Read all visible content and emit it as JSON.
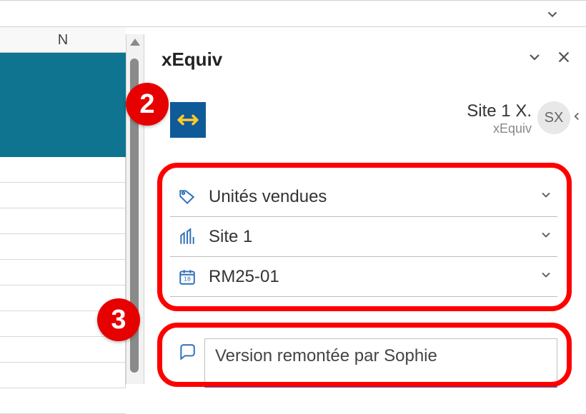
{
  "spreadsheet": {
    "column_label": "N"
  },
  "panel": {
    "title": "xEquiv",
    "site": {
      "name": "Site 1 X.",
      "sub": "xEquiv",
      "initials": "SX"
    },
    "fields": [
      {
        "icon": "tag",
        "label": "Unités vendues"
      },
      {
        "icon": "building",
        "label": "Site 1"
      },
      {
        "icon": "calendar",
        "label": "RM25-01"
      }
    ],
    "comment": "Version remontée par Sophie"
  },
  "badges": {
    "two": "2",
    "three": "3"
  }
}
